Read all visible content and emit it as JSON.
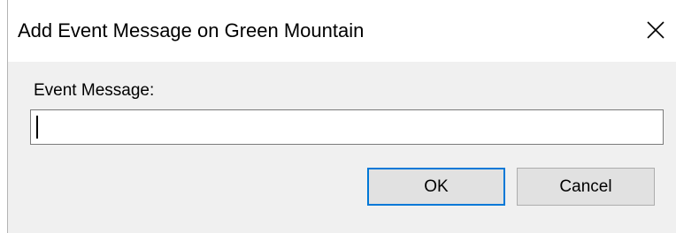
{
  "window": {
    "title": "Add Event Message on Green Mountain",
    "close_icon": "close-icon"
  },
  "form": {
    "label": "Event Message:",
    "input_value": "",
    "input_placeholder": ""
  },
  "buttons": {
    "ok_label": "OK",
    "cancel_label": "Cancel"
  },
  "colors": {
    "accent": "#0078d7",
    "dialog_bg": "#f0f0f0",
    "titlebar_bg": "#ffffff"
  }
}
